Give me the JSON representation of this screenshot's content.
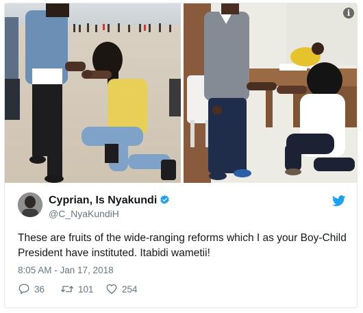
{
  "tweet": {
    "author_name": "Cyprian, Is Nyakundi",
    "handle": "@C_NyaKundiH",
    "text": "These are fruits of the wide-ranging reforms which I as your Boy-Child President have instituted. Itabidi wametii!",
    "timestamp": "8:05 AM - Jan 17, 2018",
    "replies": "36",
    "retweets": "101",
    "likes": "254"
  },
  "icons": {
    "info": "info-icon",
    "verified": "verified-badge-icon",
    "brand": "twitter-bird-icon",
    "reply": "reply-icon",
    "retweet": "retweet-icon",
    "like": "heart-icon"
  },
  "colors": {
    "brand_blue": "#1da1f2",
    "text_primary": "#14171a",
    "text_secondary": "#657786",
    "border": "#e1e8ed"
  }
}
